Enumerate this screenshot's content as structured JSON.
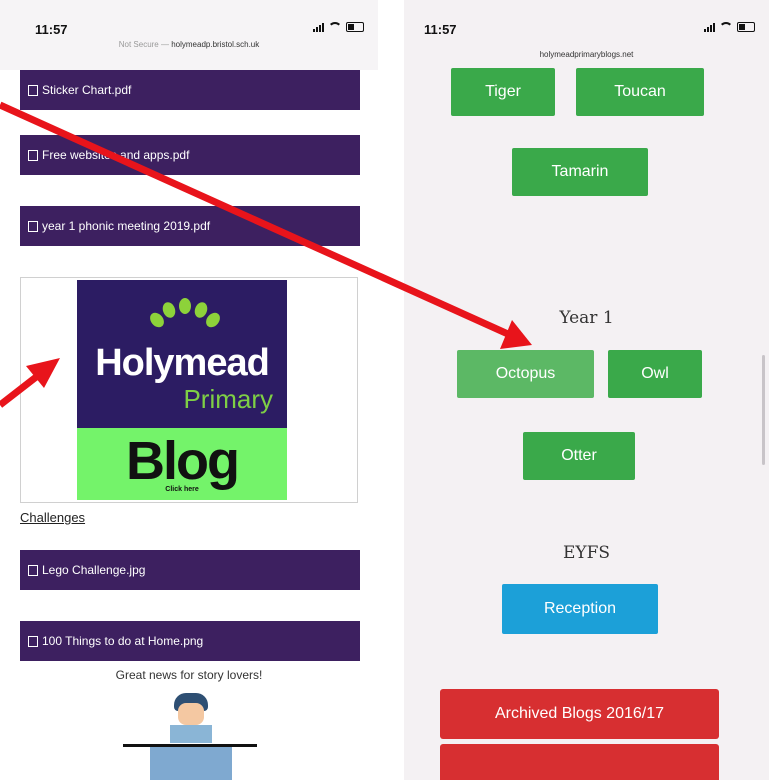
{
  "left": {
    "status": {
      "time": "11:57",
      "url_prefix": "Not Secure — ",
      "url": "holymeadp.bristol.sch.uk"
    },
    "files": [
      {
        "label": "Sticker Chart.pdf"
      },
      {
        "label": "Free websites and apps.pdf"
      },
      {
        "label": "year 1 phonic meeting 2019.pdf"
      }
    ],
    "logo": {
      "name": "Holymead",
      "school": "Primary",
      "blog": "Blog",
      "click": "Click here"
    },
    "challenges_link": "Challenges",
    "challenge_files": [
      {
        "label": "Lego Challenge.jpg"
      },
      {
        "label": "100 Things to do at Home.png"
      }
    ],
    "story_text": "Great news for story lovers!"
  },
  "right": {
    "status": {
      "time": "11:57",
      "url": "holymeadprimaryblogs.net"
    },
    "class_buttons_top": [
      "Tiger",
      "Toucan",
      "Tamarin"
    ],
    "year1": {
      "heading": "Year 1",
      "buttons": [
        "Octopus",
        "Owl",
        "Otter"
      ]
    },
    "eyfs": {
      "heading": "EYFS",
      "button": "Reception"
    },
    "archived_button": "Archived Blogs 2016/17",
    "colors": {
      "green": "#3aa94a",
      "blue": "#1ca0d8",
      "red": "#d72f31",
      "purple": "#3d2060"
    }
  },
  "annotations": {
    "arrow_color": "#e8141b"
  }
}
